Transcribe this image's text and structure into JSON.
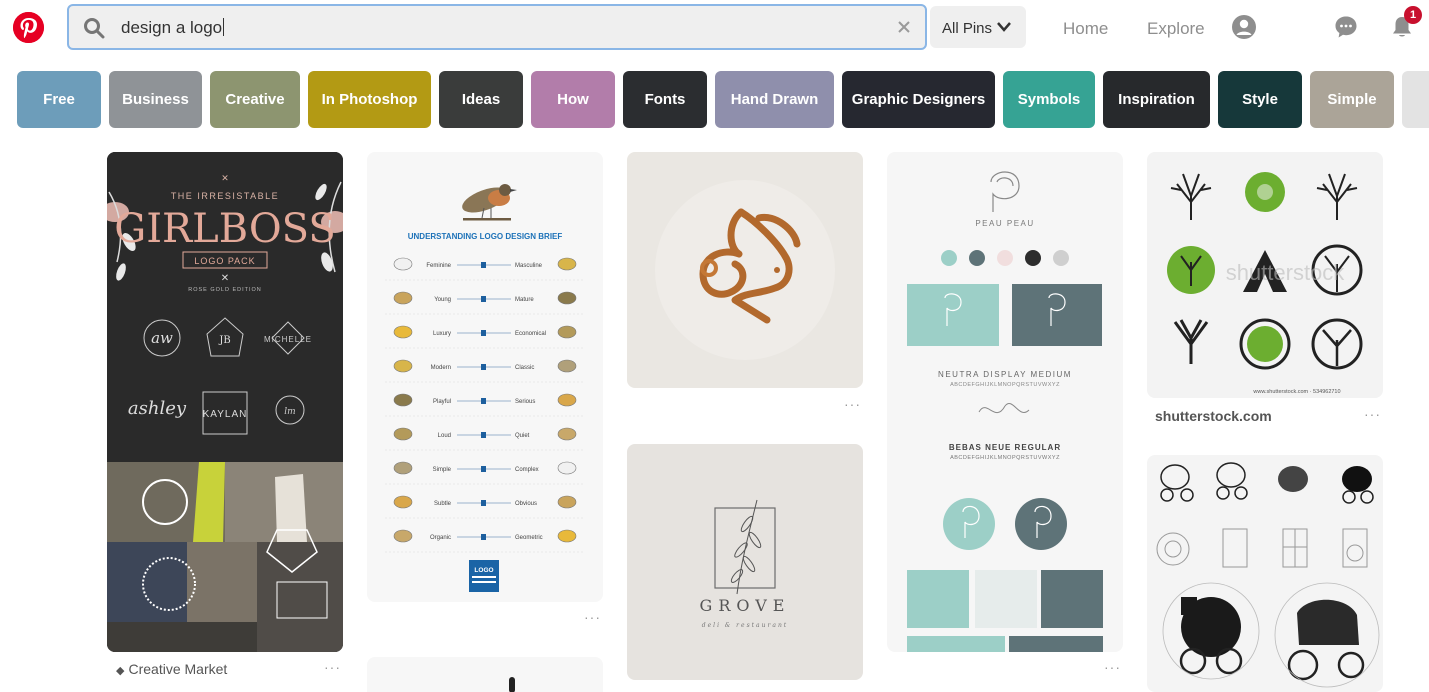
{
  "header": {
    "search": {
      "query": "design a logo"
    },
    "scope_label": "All Pins",
    "nav": {
      "home": "Home",
      "explore": "Explore"
    },
    "notifications_count": "1",
    "icons": [
      "pinterest-logo-icon",
      "search-icon",
      "clear-icon",
      "chevron-down-icon",
      "profile-icon",
      "messages-icon",
      "notifications-bell-icon"
    ]
  },
  "chips": [
    {
      "label": "Free",
      "color": "#6d9dba"
    },
    {
      "label": "Business",
      "color": "#8f9397"
    },
    {
      "label": "Creative",
      "color": "#8d9570"
    },
    {
      "label": "In Photoshop",
      "color": "#b39a14"
    },
    {
      "label": "Ideas",
      "color": "#3a3c3b"
    },
    {
      "label": "How",
      "color": "#b27daa"
    },
    {
      "label": "Fonts",
      "color": "#2b2d30"
    },
    {
      "label": "Hand Drawn",
      "color": "#8f8fac"
    },
    {
      "label": "Graphic Designers",
      "color": "#262830"
    },
    {
      "label": "Symbols",
      "color": "#36a394"
    },
    {
      "label": "Inspiration",
      "color": "#27292c"
    },
    {
      "label": "Style",
      "color": "#16383a"
    },
    {
      "label": "Simple",
      "color": "#aba498"
    },
    {
      "label": "",
      "color": "#e3e3e3"
    }
  ],
  "pins": {
    "girlboss": {
      "title_line": "THE IRRESISTABLE",
      "title": "GIRLBOSS",
      "ribbon": "LOGO PACK",
      "edition": "ROSE GOLD EDITION",
      "names": [
        "ashley",
        "KAYLAN",
        "MICHELLE",
        "JB"
      ],
      "source": "Creative Market"
    },
    "brief": {
      "heading": "UNDERSTANDING LOGO DESIGN BRIEF",
      "rows": [
        [
          "Feminine",
          "Masculine"
        ],
        [
          "Young",
          "Mature"
        ],
        [
          "Luxury",
          "Economical"
        ],
        [
          "Modern",
          "Classic"
        ],
        [
          "Playful",
          "Serious"
        ],
        [
          "Loud",
          "Quiet"
        ],
        [
          "Simple",
          "Complex"
        ],
        [
          "Subtle",
          "Obvious"
        ],
        [
          "Organic",
          "Geometric"
        ]
      ],
      "badge": "LOGO"
    },
    "grove": {
      "name": "GROVE",
      "subtitle": "deli & restaurant"
    },
    "peau": {
      "brand": "PEAU PEAU",
      "font1": "NEUTRA DISPLAY MEDIUM",
      "alphabet1": "ABCDEFGHIJKLMNOPQRSTUVWXYZ",
      "font2": "BEBAS NEUE REGULAR",
      "alphabet2": "ABCDEFGHIJKLMNOPQRSTUVWXYZ",
      "swatches": [
        "#9ccfc7",
        "#5e7378",
        "#f1dede",
        "#2d2d2d",
        "#cfcfcf"
      ]
    },
    "trees": {
      "watermark": "shutterstock",
      "credit": "www.shutterstock.com · 534962710",
      "source": "shutterstock.com"
    },
    "more_label": "···"
  }
}
